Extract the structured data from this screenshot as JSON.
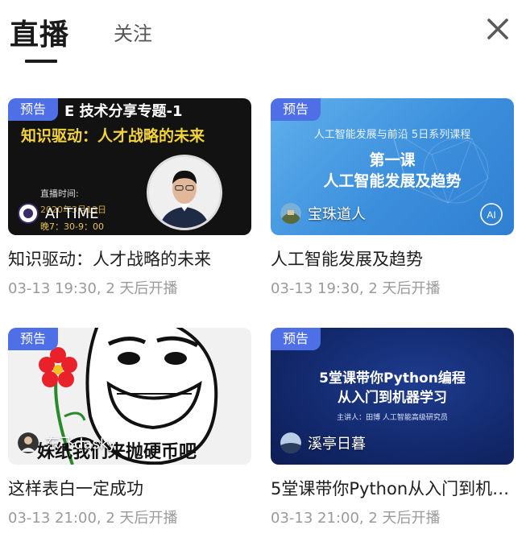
{
  "header": {
    "active_tab": "直播",
    "other_tab": "关注",
    "close_icon": "close-icon"
  },
  "colors": {
    "badge": "#4f6fe6",
    "title_text": "#1e1e1e",
    "time_text": "#9a9a9a"
  },
  "cards": [
    {
      "badge": "预告",
      "thumb_line1": "E  技术分享专题-1",
      "thumb_line2": "知识驱动：人才战略的未来",
      "thumb_live_label": "直播时间:",
      "thumb_live_date": "2020年3月13日",
      "thumb_live_hour": "晚7：30-9：00",
      "author": "AI TIME",
      "title": "知识驱动：人才战略的未来",
      "time": "03-13 19:30, 2 天后开播"
    },
    {
      "badge": "预告",
      "thumb_sub": "人工智能发展与前沿  5日系列课程",
      "thumb_line1": "第一课",
      "thumb_line2": "人工智能发展及趋势",
      "author": "宝珠道人",
      "title": "人工智能发展及趋势",
      "time": "03-13 19:30, 2 天后开播"
    },
    {
      "badge": "预告",
      "thumb_text": "妹纸我们来抛硬币吧",
      "author": "东飞dasky",
      "title": "这样表白一定成功",
      "time": "03-13 21:00, 2 天后开播"
    },
    {
      "badge": "预告",
      "thumb_line1": "5堂课带你Python编程",
      "thumb_line2": "从入门到机器学习",
      "thumb_speaker": "主讲人：田博  人工智能高级研究员",
      "author": "溪亭日暮",
      "title": "5堂课带你Python从入门到机器学习",
      "time": "03-13 21:00, 2 天后开播"
    }
  ]
}
